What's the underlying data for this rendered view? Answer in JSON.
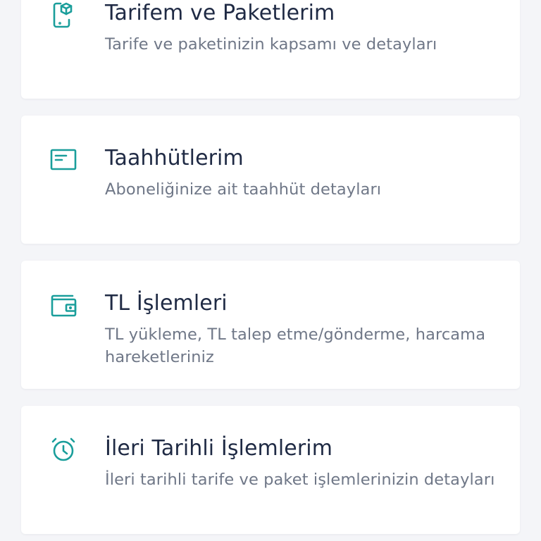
{
  "colors": {
    "background": "#f4f5f8",
    "card": "#ffffff",
    "title": "#1f2a44",
    "subtitle": "#6f7787",
    "accent": "#1a9e9b"
  },
  "menu": {
    "items": [
      {
        "icon": "phone-package-icon",
        "title": "Tarifem ve Paketlerim",
        "subtitle": "Tarife ve paketinizin kapsamı ve detayları"
      },
      {
        "icon": "document-icon",
        "title": "Taahhütlerim",
        "subtitle": "Aboneliğinize ait taahhüt detayları"
      },
      {
        "icon": "wallet-icon",
        "title": "TL İşlemleri",
        "subtitle": "TL yükleme, TL talep etme/gönderme, harcama hareketleriniz"
      },
      {
        "icon": "alarm-clock-icon",
        "title": "İleri Tarihli İşlemlerim",
        "subtitle": "İleri tarihli tarife ve paket işlemlerinizin detayları"
      }
    ]
  }
}
